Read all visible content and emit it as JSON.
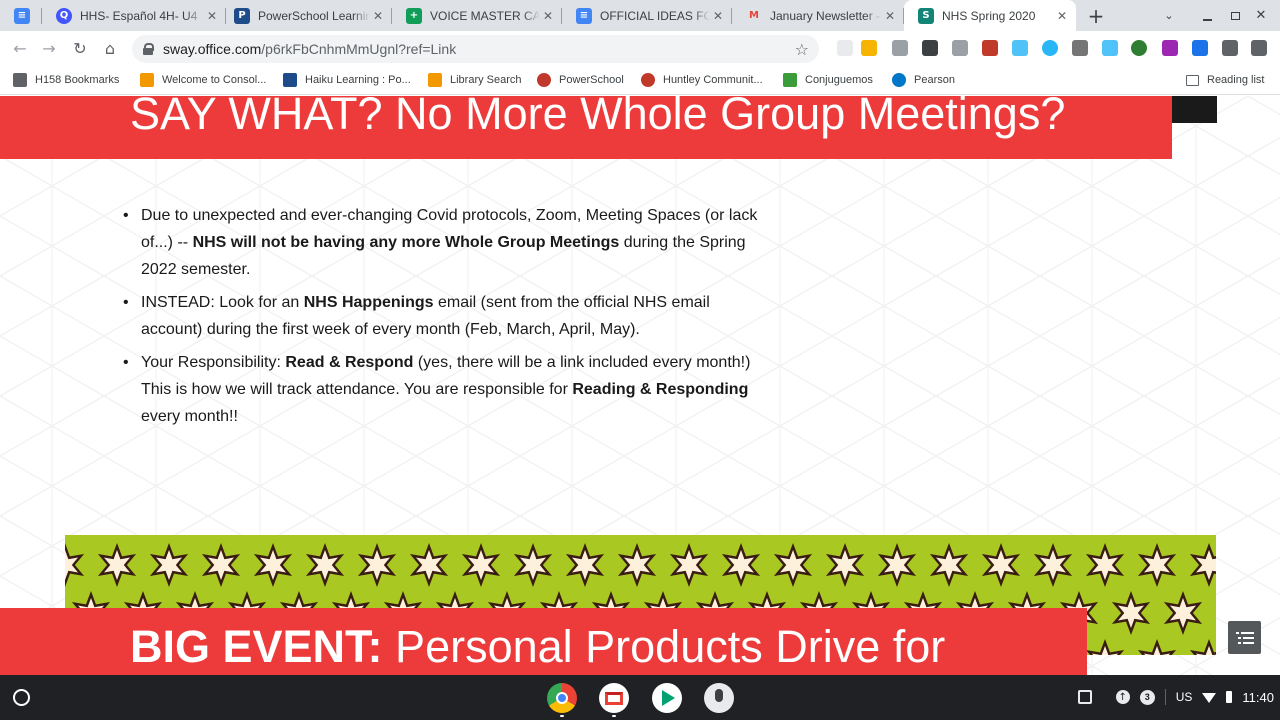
{
  "tabs": [
    {
      "title": "HHS- Español 4H- U4",
      "icon": "quizlet-icon",
      "color": "#4255ff",
      "active": false
    },
    {
      "title": "PowerSchool Learning",
      "icon": "powerschool-icon",
      "color": "#1e4c8a",
      "active": false
    },
    {
      "title": "VOICE MASTER CALENDAR",
      "icon": "sheets-icon",
      "color": "#0f9d58",
      "active": false
    },
    {
      "title": "OFFICIAL IDEAS FOR F",
      "icon": "docs-icon",
      "color": "#4285f4",
      "active": false
    },
    {
      "title": "January Newsletter - F",
      "icon": "gmail-icon",
      "color": "#ea4335",
      "active": false
    },
    {
      "title": "NHS Spring 2020",
      "icon": "sway-icon",
      "color": "#138577",
      "active": true
    }
  ],
  "toolbar": {
    "url_host": "sway.office.com",
    "url_path": "/p6rkFbCnhmMmUgnl?ref=Link"
  },
  "bookmarks": [
    {
      "label": "H158 Bookmarks",
      "icon": "folder-icon",
      "color": "#5f6368"
    },
    {
      "label": "Welcome to Consol...",
      "icon": "location-icon",
      "color": "#f29900"
    },
    {
      "label": "Haiku Learning : Po...",
      "icon": "powerschool-icon",
      "color": "#1e4c8a"
    },
    {
      "label": "Library Search",
      "icon": "location-icon",
      "color": "#f29900"
    },
    {
      "label": "PowerSchool",
      "icon": "powerschool-circle-icon",
      "color": "#c0392b"
    },
    {
      "label": "Huntley Communit...",
      "icon": "powerschool-circle-icon",
      "color": "#c0392b"
    },
    {
      "label": "Conjuguemos",
      "icon": "frog-icon",
      "color": "#3a9d3a"
    },
    {
      "label": "Pearson",
      "icon": "pearson-icon",
      "color": "#0077c8"
    }
  ],
  "reading_list": "Reading list",
  "page": {
    "heading1": "SAY WHAT?  No More Whole Group Meetings?",
    "bullets": [
      {
        "segments": [
          {
            "text": "Due to unexpected and ever-changing Covid protocols, Zoom, Meeting Spaces (or lack of...) -- ",
            "bold": false
          },
          {
            "text": "NHS will not be having any more Whole Group Meetings",
            "bold": true
          },
          {
            "text": " during the Spring 2022 semester.",
            "bold": false
          }
        ]
      },
      {
        "segments": [
          {
            "text": "INSTEAD:  Look for an ",
            "bold": false
          },
          {
            "text": "NHS Happenings",
            "bold": true
          },
          {
            "text": " email (sent from the official NHS email account) during the first week of every month (Feb, March, April, May).",
            "bold": false
          }
        ]
      },
      {
        "segments": [
          {
            "text": "Your Responsibility:  ",
            "bold": false
          },
          {
            "text": "Read & Respond",
            "bold": true
          },
          {
            "text": " (yes, there will be a link included every month!)  This is how we will track attendance.  You are responsible for ",
            "bold": false
          },
          {
            "text": "Reading & Responding",
            "bold": true
          },
          {
            "text": " every month!!",
            "bold": false
          }
        ]
      }
    ],
    "heading2_bold": "BIG EVENT:",
    "heading2_rest": "  Personal Products Drive for"
  },
  "shelf": {
    "apps": [
      {
        "name": "chrome-icon"
      },
      {
        "name": "gmail-icon"
      },
      {
        "name": "play-store-icon"
      },
      {
        "name": "voice-recorder-icon"
      }
    ],
    "notification_count": "3",
    "keyboard": "US",
    "time": "11:40"
  },
  "colors": {
    "banner": "#ed3b3b",
    "pattern_green": "#a9c922",
    "shelf": "#202124"
  }
}
